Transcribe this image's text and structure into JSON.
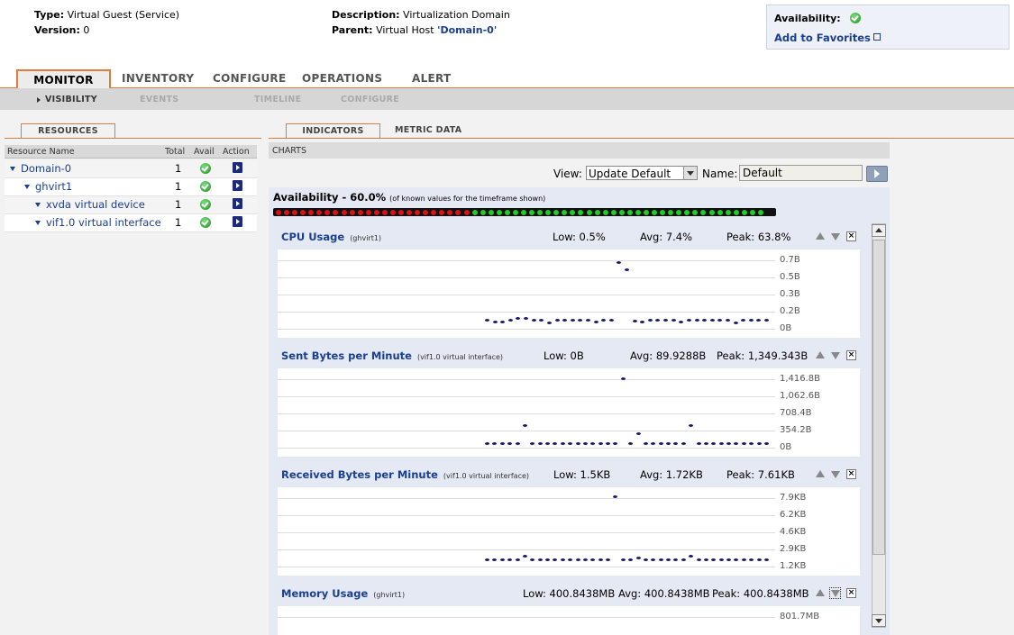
{
  "header": {
    "type_label": "Type:",
    "type_value": "Virtual Guest (Service)",
    "version_label": "Version:",
    "version_value": "0",
    "description_label": "Description:",
    "description_value": "Virtualization Domain",
    "parent_label": "Parent:",
    "parent_prefix": "Virtual Host",
    "parent_link": "'Domain-0'",
    "availability_label": "Availability:",
    "add_favorites": "Add to Favorites"
  },
  "tabs": [
    "MONITOR",
    "INVENTORY",
    "CONFIGURE",
    "OPERATIONS",
    "ALERT"
  ],
  "subtabs": [
    "VISIBILITY",
    "EVENTS",
    "TIMELINE",
    "CONFIGURE"
  ],
  "resources": {
    "tab": "RESOURCES",
    "columns": [
      "Resource Name",
      "Total",
      "Avail",
      "Action"
    ],
    "rows": [
      {
        "name": "Domain-0",
        "total": "1"
      },
      {
        "name": "ghvirt1",
        "total": "1"
      },
      {
        "name": "xvda virtual device",
        "total": "1"
      },
      {
        "name": "vif1.0 virtual interface",
        "total": "1"
      }
    ]
  },
  "right_tabs": [
    "INDICATORS",
    "METRIC DATA"
  ],
  "charts_header": "CHARTS",
  "view_label": "View:",
  "view_value": "Update Default",
  "name_label": "Name:",
  "name_value": "Default",
  "availability_summary": {
    "label": "Availability - 60.0%",
    "note": "(of known values for the timeframe shown)",
    "red_count": 24,
    "green_count": 36
  },
  "charts": [
    {
      "title": "CPU Usage",
      "sub": "(ghvirt1)",
      "low": "Low: 0.5%",
      "avg": "Avg: 7.4%",
      "peak": "Peak: 63.8%",
      "yticks": [
        "0.7B",
        "0.5B",
        "0.3B",
        "0.2B",
        "0B"
      ]
    },
    {
      "title": "Sent Bytes per Minute",
      "sub": "(vif1.0 virtual interface)",
      "low": "Low: 0B",
      "avg": "Avg: 89.9288B",
      "peak": "Peak: 1,349.343B",
      "yticks": [
        "1,416.8B",
        "1,062.6B",
        "708.4B",
        "354.2B",
        "0B"
      ]
    },
    {
      "title": "Received Bytes per Minute",
      "sub": "(vif1.0 virtual interface)",
      "low": "Low: 1.5KB",
      "avg": "Avg: 1.72KB",
      "peak": "Peak: 7.61KB",
      "yticks": [
        "7.9KB",
        "6.2KB",
        "4.6KB",
        "2.9KB",
        "1.2KB"
      ]
    },
    {
      "title": "Memory Usage",
      "sub": "(ghvirt1)",
      "low": "Low: 400.8438MB",
      "avg": "Avg: 400.8438MB",
      "peak": "Peak: 400.8438MB",
      "yticks": [
        "801.7MB"
      ]
    }
  ],
  "chart_data": [
    {
      "type": "scatter",
      "title": "CPU Usage",
      "ylim": [
        0,
        0.7
      ],
      "y": [
        0.05,
        0.03,
        0.03,
        0.05,
        0.06,
        0.06,
        0.05,
        0.05,
        0.02,
        0.05,
        0.05,
        0.05,
        0.05,
        0.05,
        0.03,
        0.05,
        0.05,
        0.64,
        0.56,
        0.04,
        0.03,
        0.05,
        0.05,
        0.05,
        0.05,
        0.03,
        0.05,
        0.05,
        0.05,
        0.05,
        0.05,
        0.05,
        0.02,
        0.05,
        0.05,
        0.05,
        0.05
      ]
    },
    {
      "type": "scatter",
      "title": "Sent Bytes per Minute",
      "ylim": [
        0,
        1416.8
      ],
      "y": [
        0,
        0,
        0,
        0,
        0,
        380,
        0,
        0,
        0,
        0,
        0,
        0,
        0,
        0,
        0,
        0,
        0,
        0,
        1349,
        0,
        210,
        0,
        0,
        0,
        0,
        0,
        0,
        380,
        0,
        0,
        0,
        0,
        0,
        0,
        0,
        0,
        0,
        0
      ]
    },
    {
      "type": "scatter",
      "title": "Received Bytes per Minute",
      "ylim": [
        1.2,
        7.9
      ],
      "y": [
        1.5,
        1.5,
        1.5,
        1.5,
        1.5,
        1.8,
        1.5,
        1.5,
        1.5,
        1.5,
        1.5,
        1.5,
        1.5,
        1.5,
        1.5,
        1.5,
        1.5,
        7.61,
        1.5,
        1.5,
        1.6,
        1.5,
        1.5,
        1.5,
        1.5,
        1.5,
        1.5,
        1.8,
        1.5,
        1.5,
        1.5,
        1.5,
        1.5,
        1.5,
        1.5,
        1.5,
        1.5,
        1.5
      ]
    }
  ]
}
